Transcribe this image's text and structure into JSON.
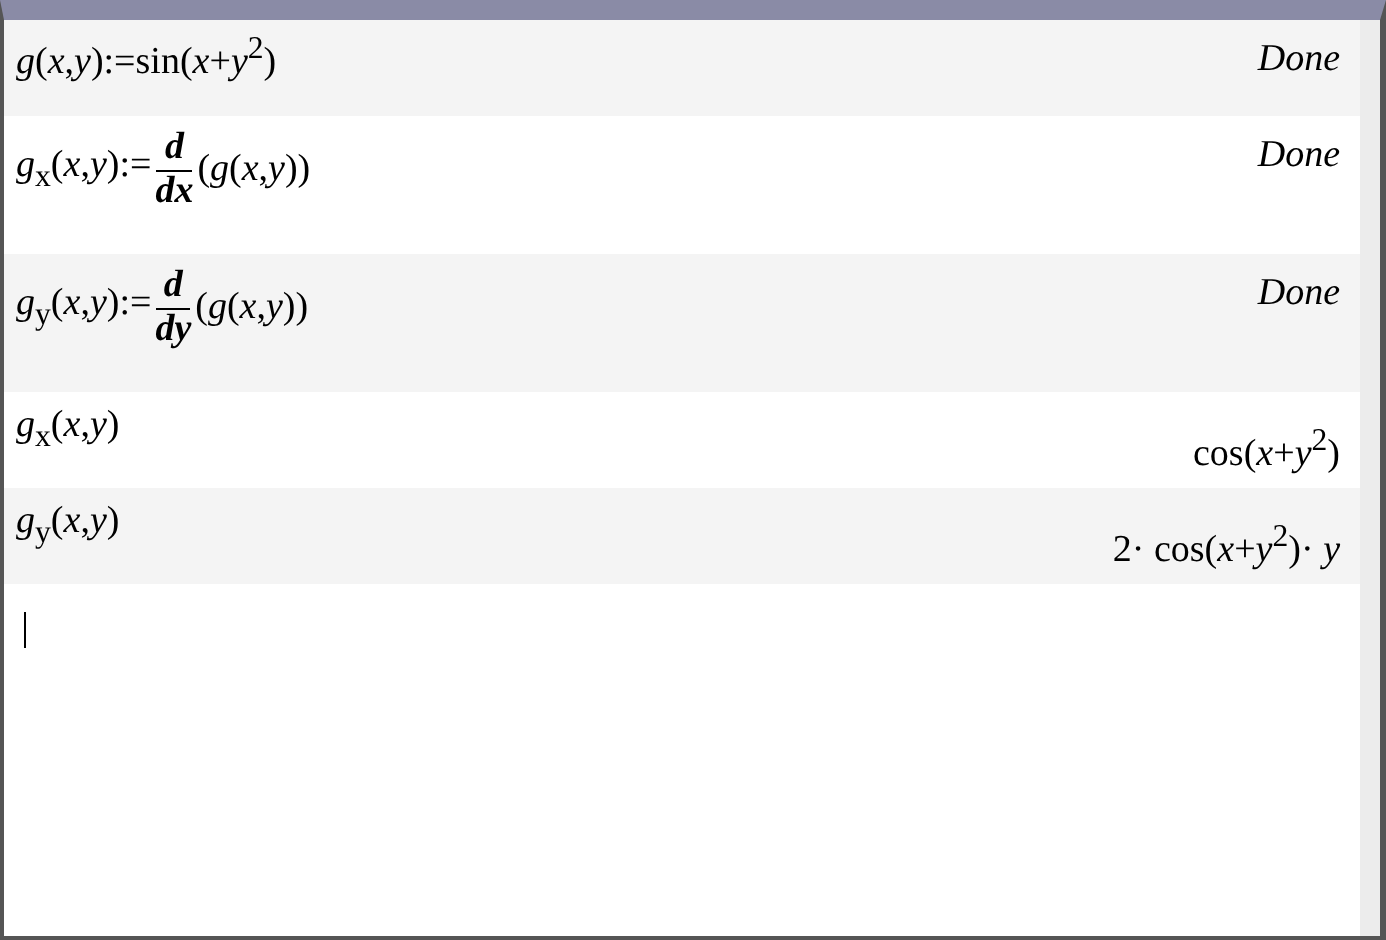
{
  "entries": [
    {
      "input": [
        {
          "kind": "text",
          "text": "*g*(*x*,*y*):=sin(*x*+*y*$^{2}$)"
        }
      ],
      "result": {
        "kind": "message",
        "text": "Done"
      }
    },
    {
      "input": [
        {
          "kind": "text",
          "text": "*g*$_{x}$(*x*,*y*):="
        },
        {
          "kind": "fraction",
          "numerator": "d",
          "denominator": "dx"
        },
        {
          "kind": "text",
          "text": "(*g*(*x*,*y*))"
        }
      ],
      "result": {
        "kind": "message",
        "text": "Done"
      }
    },
    {
      "input": [
        {
          "kind": "text",
          "text": "*g*$_{y}$(*x*,*y*):="
        },
        {
          "kind": "fraction",
          "numerator": "d",
          "denominator": "dy"
        },
        {
          "kind": "text",
          "text": "(*g*(*x*,*y*))"
        }
      ],
      "result": {
        "kind": "message",
        "text": "Done"
      }
    },
    {
      "input": [
        {
          "kind": "text",
          "text": "*g*$_{x}$(*x*,*y*)"
        }
      ],
      "result": {
        "kind": "math",
        "text": "cos(*x*+*y*$^{2}$)"
      }
    },
    {
      "input": [
        {
          "kind": "text",
          "text": "*g*$_{y}$(*x*,*y*)"
        }
      ],
      "result": {
        "kind": "math",
        "text": "2· cos(*x*+*y*$^{2}$)· *y*"
      }
    }
  ]
}
